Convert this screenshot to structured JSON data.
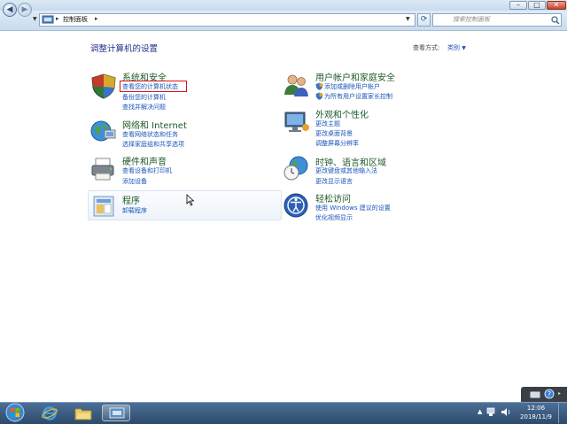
{
  "window": {
    "address_path": "控制面板",
    "search_placeholder": "搜索控制面板",
    "back_icon": "back-arrow-icon",
    "forward_icon": "forward-arrow-icon"
  },
  "page": {
    "heading": "调整计算机的设置",
    "view_by_label": "查看方式:",
    "view_by_value": "类别"
  },
  "categories_left": [
    {
      "title": "系统和安全",
      "icon": "shield-icon",
      "links": [
        "查看您的计算机状态",
        "备份您的计算机",
        "查找并解决问题"
      ]
    },
    {
      "title": "网络和 Internet",
      "icon": "network-globe-icon",
      "links": [
        "查看网络状态和任务",
        "选择家庭组和共享选项"
      ]
    },
    {
      "title": "硬件和声音",
      "icon": "printer-icon",
      "links": [
        "查看设备和打印机",
        "添加设备"
      ]
    },
    {
      "title": "程序",
      "icon": "programs-icon",
      "links": [
        "卸载程序"
      ]
    }
  ],
  "categories_right": [
    {
      "title": "用户帐户和家庭安全",
      "icon": "users-icon",
      "links": [
        "添加或删除用户帐户",
        "为所有用户设置家长控制"
      ]
    },
    {
      "title": "外观和个性化",
      "icon": "display-icon",
      "links": [
        "更改主题",
        "更改桌面背景",
        "调整屏幕分辨率"
      ]
    },
    {
      "title": "时钟、语言和区域",
      "icon": "clock-globe-icon",
      "links": [
        "更改键盘或其他输入法",
        "更改显示语言"
      ]
    },
    {
      "title": "轻松访问",
      "icon": "ease-of-access-icon",
      "links": [
        "使用 Windows 建议的设置",
        "优化视频显示"
      ]
    }
  ],
  "taskbar": {
    "time": "12:06",
    "date": "2018/11/9"
  },
  "colors": {
    "heading": "#1e3287",
    "category_title": "#1e5a28",
    "link": "#1a55b8",
    "highlight_border": "#dd1111",
    "taskbar": "#2c4a6c"
  }
}
